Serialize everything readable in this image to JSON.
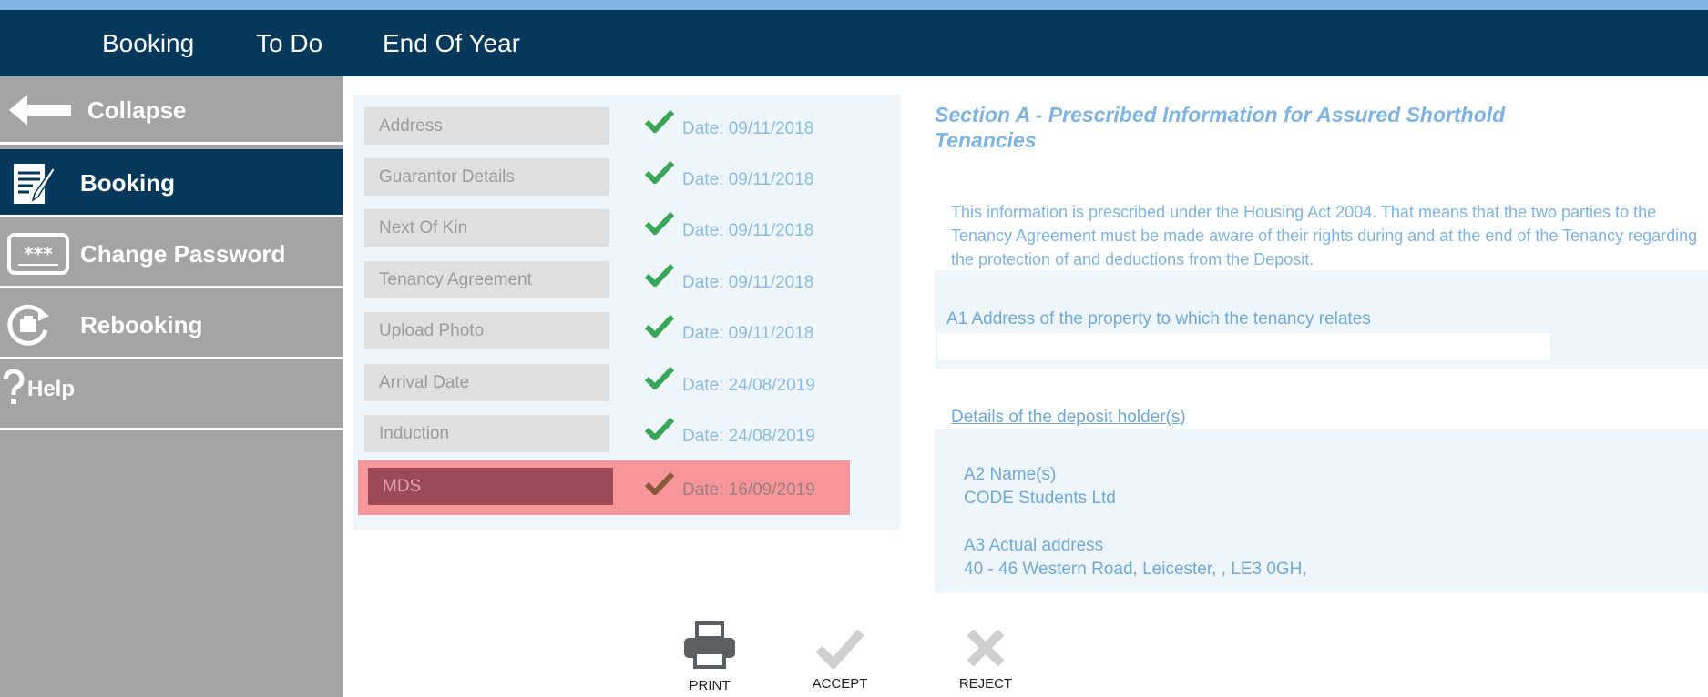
{
  "nav": {
    "items": [
      {
        "label": "Booking"
      },
      {
        "label": "To Do"
      },
      {
        "label": "End Of Year"
      }
    ]
  },
  "sidebar": {
    "items": [
      {
        "label": "Collapse",
        "icon": "arrow-left-icon"
      },
      {
        "label": "Booking",
        "icon": "booking-form-icon",
        "active": true
      },
      {
        "label": "Change Password",
        "icon": "password-icon"
      },
      {
        "label": "Rebooking",
        "icon": "rebooking-icon"
      },
      {
        "label": "Help",
        "icon": "question-icon"
      }
    ]
  },
  "checklist": {
    "rows": [
      {
        "label": "Address",
        "date": "Date: 09/11/2018",
        "status": "done"
      },
      {
        "label": "Guarantor Details",
        "date": "Date: 09/11/2018",
        "status": "done"
      },
      {
        "label": "Next Of Kin",
        "date": "Date: 09/11/2018",
        "status": "done"
      },
      {
        "label": "Tenancy Agreement",
        "date": "Date: 09/11/2018",
        "status": "done"
      },
      {
        "label": "Upload Photo",
        "date": "Date: 09/11/2018",
        "status": "done"
      },
      {
        "label": "Arrival Date",
        "date": "Date: 24/08/2019",
        "status": "done"
      },
      {
        "label": "Induction",
        "date": "Date: 24/08/2019",
        "status": "done"
      },
      {
        "label": "MDS",
        "date": "Date: 16/09/2019",
        "status": "alert"
      }
    ]
  },
  "section": {
    "title": "Section A - Prescribed Information for Assured Shorthold Tenancies",
    "intro": "This information is prescribed under the Housing Act 2004. That means that the two parties to the Tenancy Agreement must be made aware of their rights during and at the end of the Tenancy regarding the protection of and deductions from the Deposit.",
    "a1_label": "A1 Address of the property to which the tenancy relates",
    "a1_value": "",
    "deposit_link": "Details of the deposit holder(s)",
    "a2_label": "A2 Name(s)",
    "a2_value": "CODE Students Ltd",
    "a3_label": "A3 Actual address",
    "a3_value": "40 - 46 Western Road, Leicester, , LE3 0GH,"
  },
  "actions": {
    "print": "PRINT",
    "accept": "ACCEPT",
    "reject": "REJECT"
  },
  "colors": {
    "nav_bg": "#06385c",
    "accent_light": "#7fb3e0",
    "sidebar_bg": "#a4a4a4",
    "check_green": "#3aa556",
    "alert_bg": "#f7969a"
  }
}
